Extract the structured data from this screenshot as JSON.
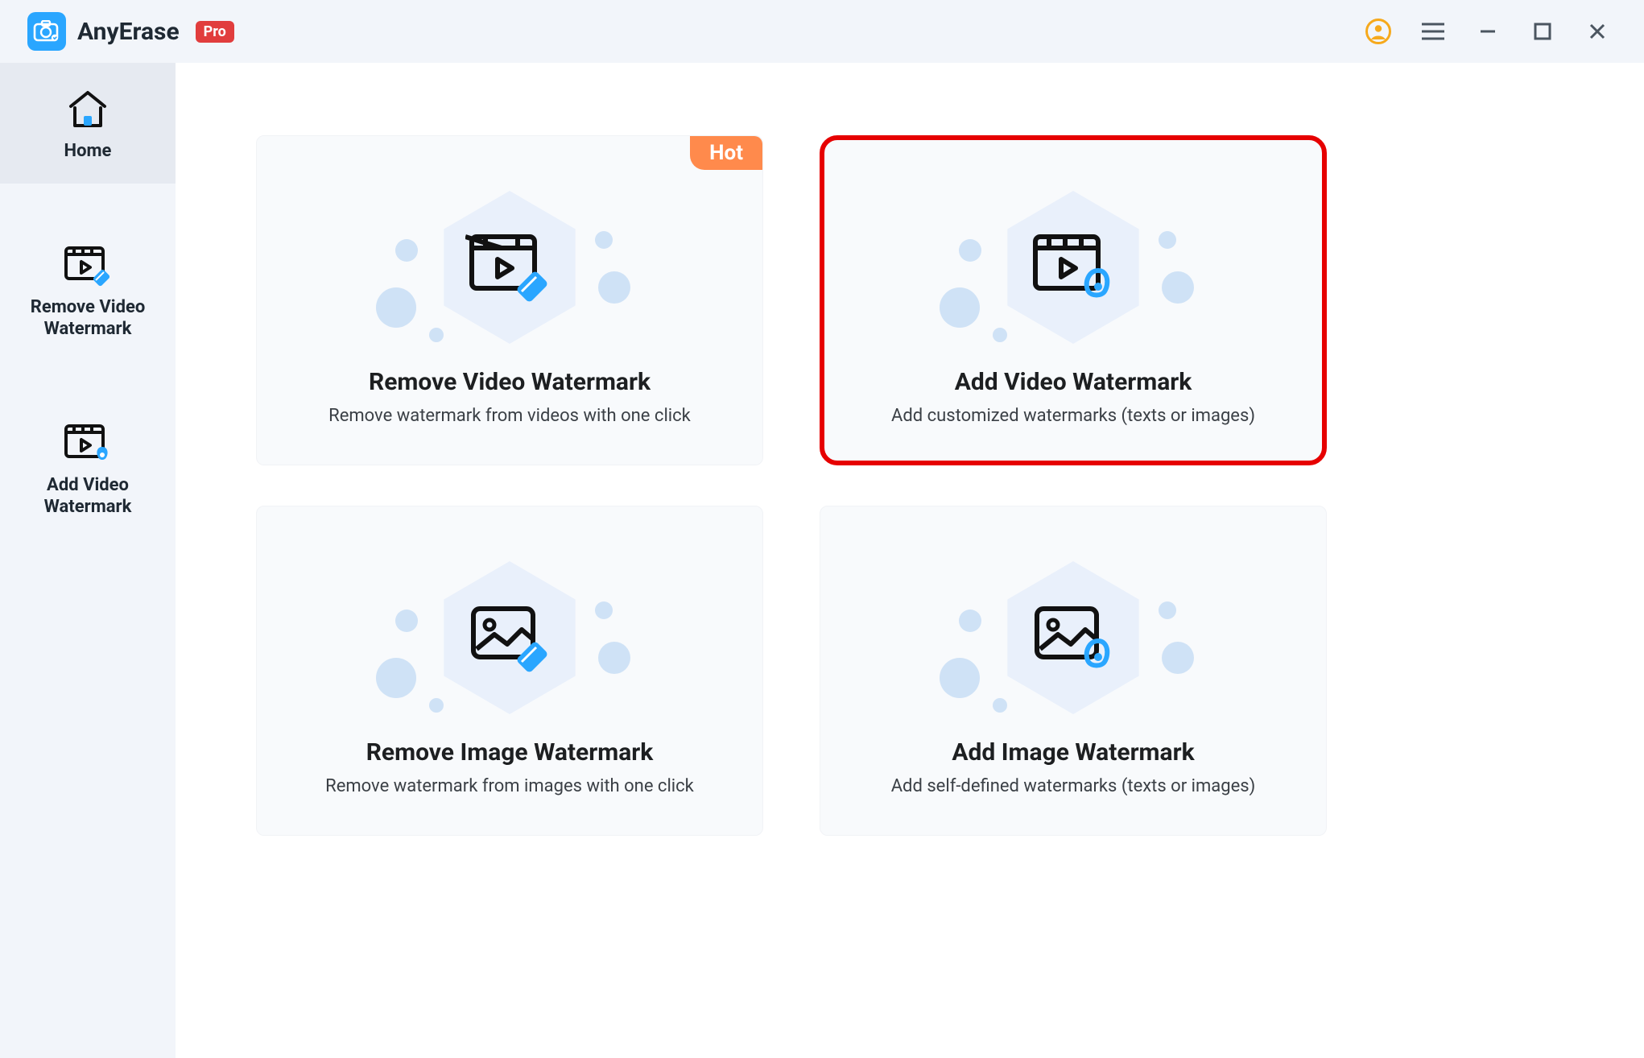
{
  "app": {
    "title": "AnyErase",
    "badge": "Pro"
  },
  "sidebar": {
    "items": [
      {
        "label": "Home"
      },
      {
        "label": "Remove Video Watermark"
      },
      {
        "label": "Add Video Watermark"
      }
    ]
  },
  "cards": [
    {
      "title": "Remove Video Watermark",
      "desc": "Remove watermark from videos with one click",
      "badge": "Hot"
    },
    {
      "title": "Add Video Watermark",
      "desc": "Add customized watermarks (texts or images)"
    },
    {
      "title": "Remove Image Watermark",
      "desc": "Remove watermark from images with one click"
    },
    {
      "title": "Add Image Watermark",
      "desc": "Add self-defined watermarks  (texts or images)"
    }
  ],
  "colors": {
    "accent": "#2aa6ff",
    "hot": "#ff8a4c",
    "highlight": "#e60000",
    "badge": "#e13d3d"
  }
}
